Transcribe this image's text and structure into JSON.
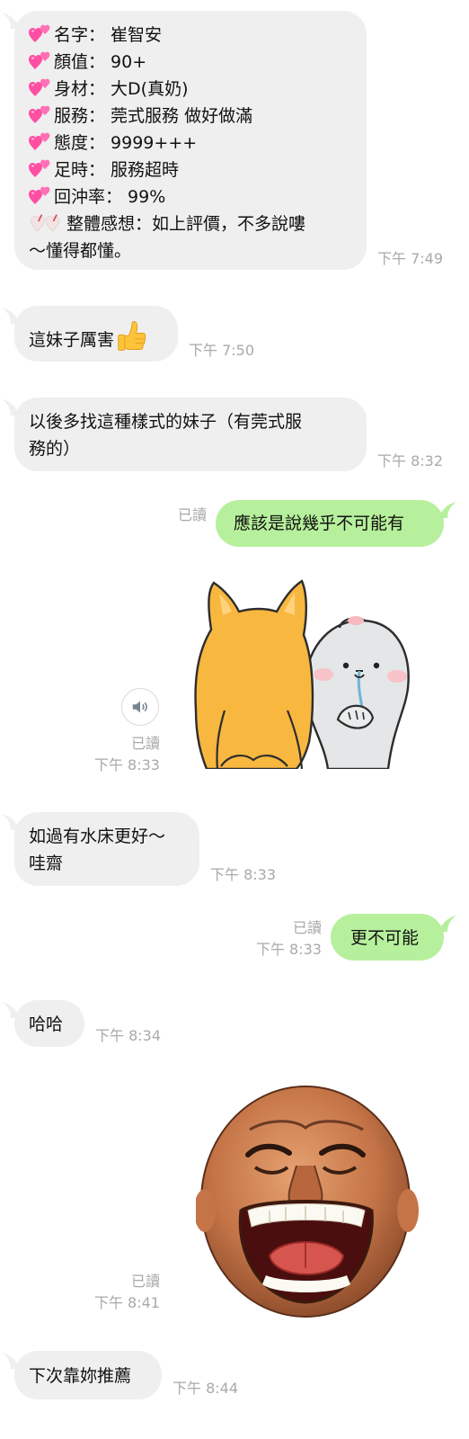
{
  "messages": [
    {
      "id": "m1",
      "from": "other",
      "lines": [
        "名字： 崔智安",
        "顏值： 90+",
        "身材： 大D(真奶)",
        "服務：  莞式服務 做好做滿",
        "態度：  9999+++",
        "足時：  服務超時",
        "回沖率： 99%",
        "整體感想：如上評價，不多說嘍",
        "～懂得都懂。"
      ],
      "time": "下午 7:49"
    },
    {
      "id": "m2",
      "from": "other",
      "text": "這妹子厲害",
      "emoji": "thumbs-up",
      "time": "下午 7:50"
    },
    {
      "id": "m3",
      "from": "other",
      "lines": [
        "以後多找這種樣式的妹子（有莞式服",
        "務的）"
      ],
      "time": "下午 8:32"
    },
    {
      "id": "m4",
      "from": "me",
      "text": "應該是說幾乎不可能有",
      "read": "已讀",
      "time": ""
    },
    {
      "id": "m5",
      "from": "me",
      "sticker": "cat-and-bunny-sticker",
      "read": "已讀",
      "time": "下午 8:33"
    },
    {
      "id": "m6",
      "from": "other",
      "lines": [
        "如過有水床更好～",
        "哇齋"
      ],
      "time": "下午 8:33"
    },
    {
      "id": "m7",
      "from": "me",
      "text": "更不可能",
      "read": "已讀",
      "time": "下午 8:33"
    },
    {
      "id": "m8",
      "from": "other",
      "text": "哈哈",
      "time": "下午 8:34"
    },
    {
      "id": "m9",
      "from": "me",
      "sticker": "laughing-face-sticker",
      "read": "已讀",
      "time": "下午 8:41"
    },
    {
      "id": "m10",
      "from": "other",
      "text": "下次靠妳推薦",
      "time": "下午 8:44"
    }
  ],
  "colors": {
    "incoming_bubble": "#efefef",
    "outgoing_bubble": "#b6f09c",
    "meta_text": "#a9a9a9",
    "heart": "#ff4fa3"
  }
}
